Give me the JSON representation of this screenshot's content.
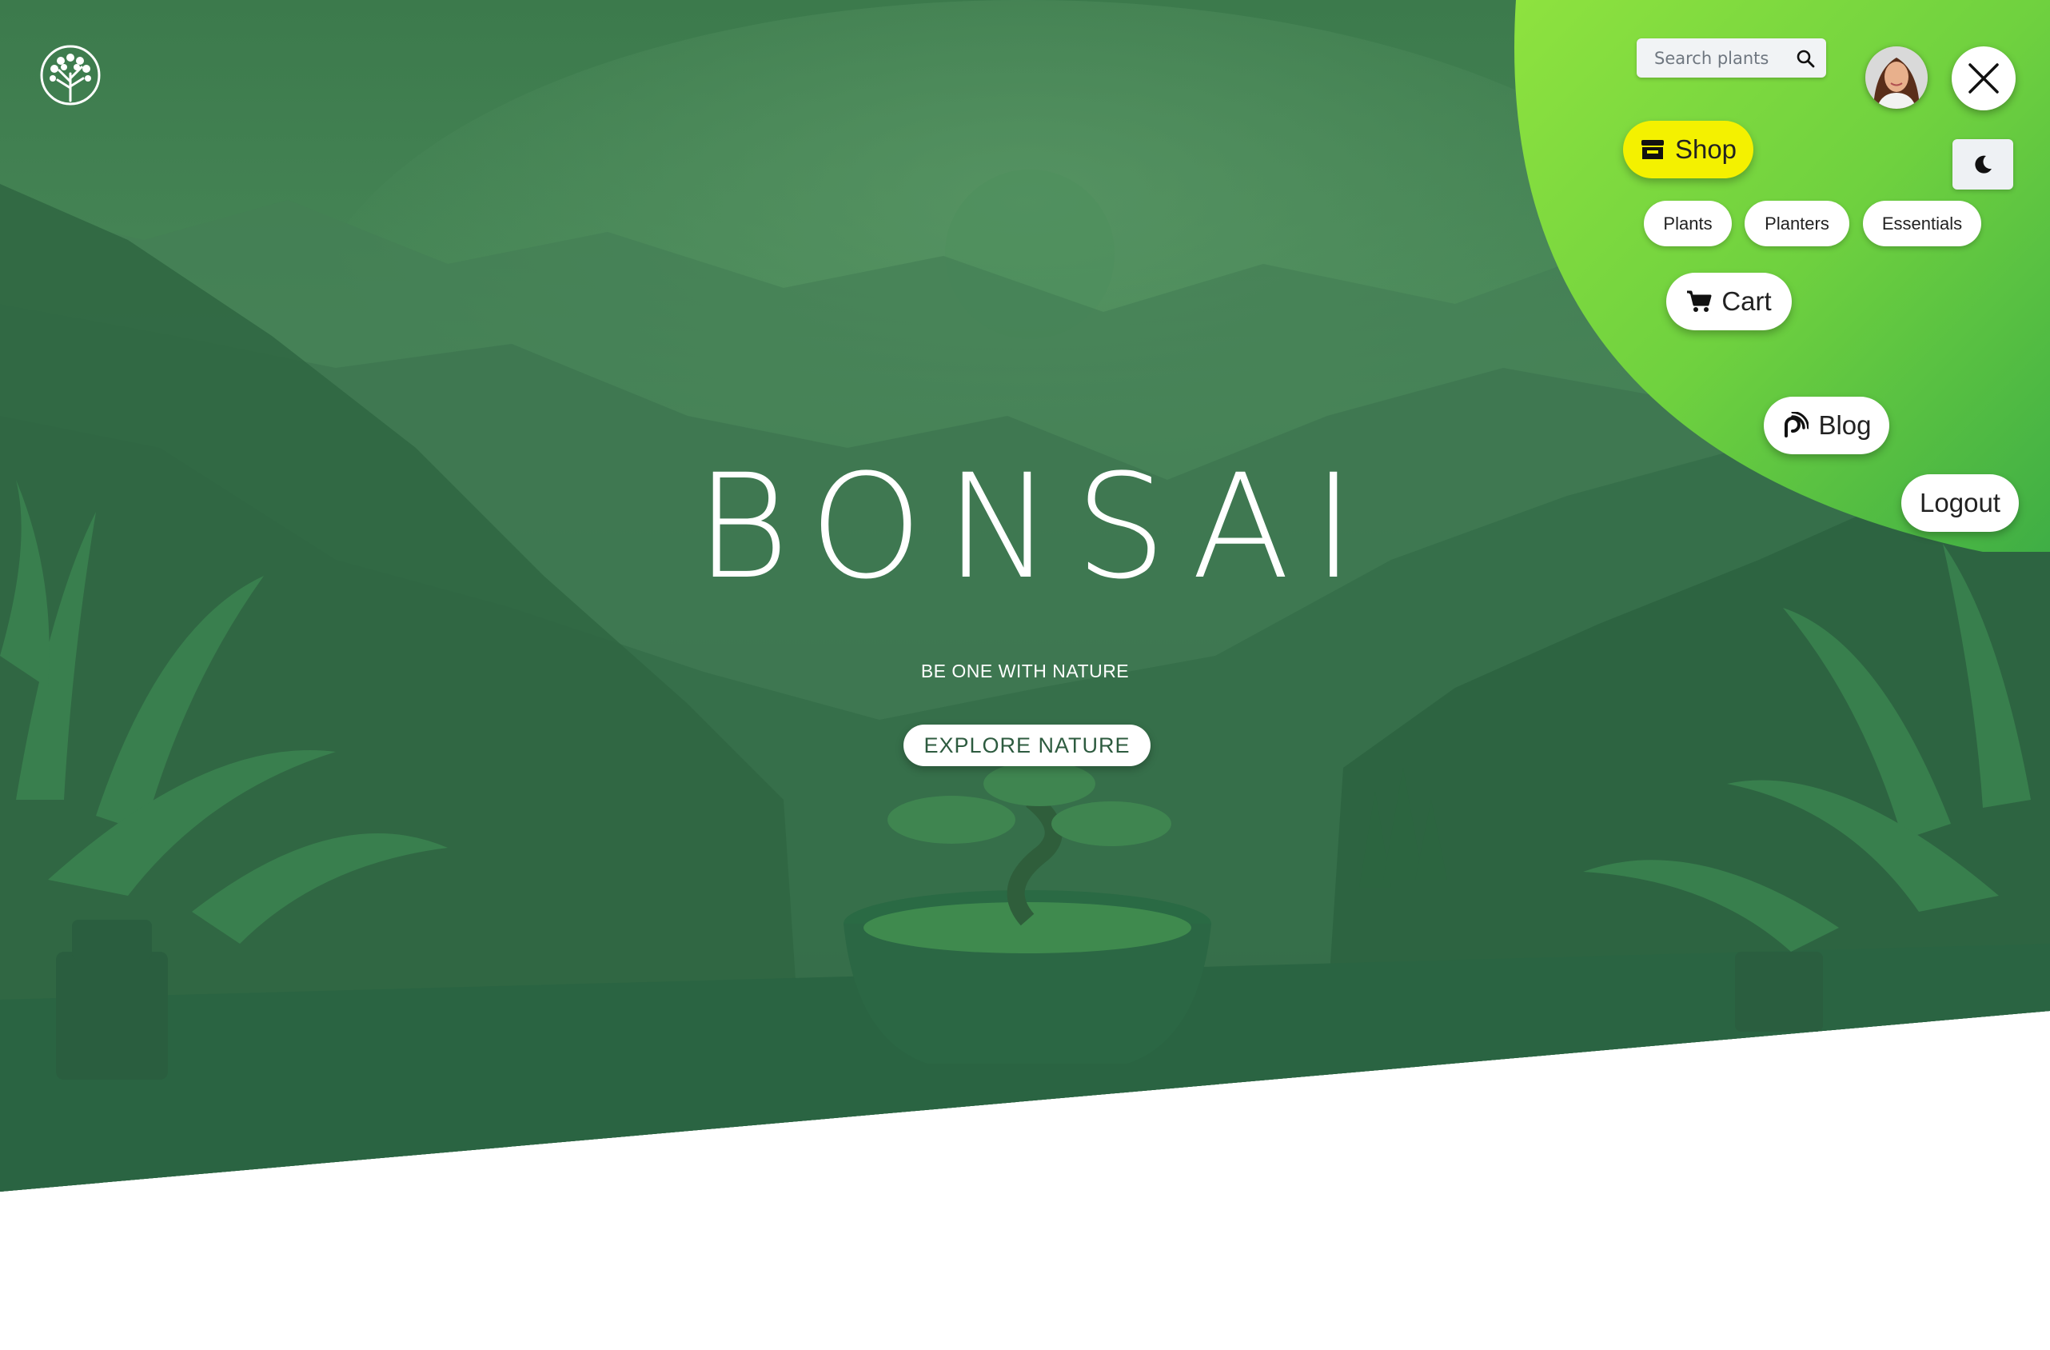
{
  "brand": {
    "title": "BONSAI",
    "tagline": "BE ONE WITH NATURE",
    "logo_icon": "tree-icon"
  },
  "hero": {
    "cta_label": "EXPLORE NATURE",
    "accent": "#2f7a4c"
  },
  "search": {
    "placeholder": "Search plants",
    "icon": "search-icon"
  },
  "menu": {
    "background_gradient": [
      "#8ee23f",
      "#3fae45"
    ],
    "active_color": "#f4f100",
    "shop": {
      "label": "Shop",
      "icon": "store-icon"
    },
    "categories": [
      "Plants",
      "Planters",
      "Essentials"
    ],
    "cart": {
      "label": "Cart",
      "icon": "cart-icon"
    },
    "blog": {
      "label": "Blog",
      "icon": "blog-icon"
    },
    "logout": {
      "label": "Logout"
    },
    "close_icon": "close-icon",
    "theme_icon": "moon-icon",
    "avatar": "user-avatar"
  }
}
